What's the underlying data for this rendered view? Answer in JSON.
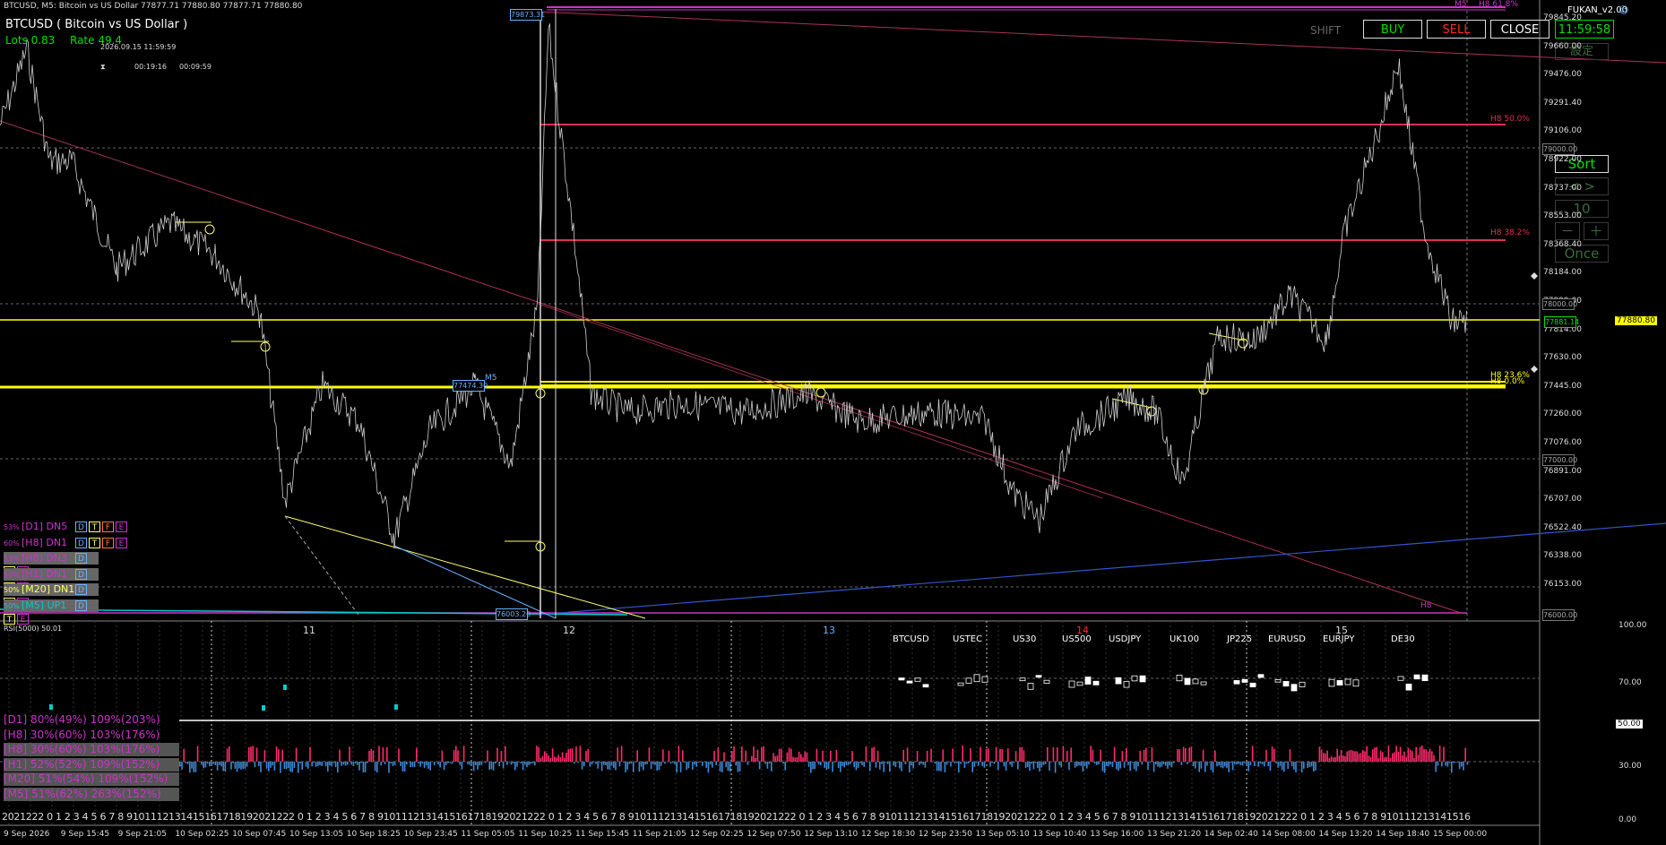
{
  "header": {
    "title": "BTCUSD, M5:  Bitcoin vs US Dollar  77877.71 77880.80 77877.71 77880.80",
    "symbol_label": "BTCUSD ( Bitcoin vs US Dollar )",
    "lots": "Lots  0.83",
    "rate": "Rate  49.4",
    "datetime": "2026.09.15 11:59:59",
    "timer_a": "00:19:16",
    "timer_b": "00:09:59",
    "timer_icon": "hourglass-icon"
  },
  "panel": {
    "ea_name": "FUKAN_v2.00",
    "shift_label": "SHIFT",
    "buy_label": "BUY",
    "sell_label": "SELL",
    "close_label": "CLOSE",
    "clock": "11:59:58",
    "settings_label": "設定",
    "sort_label": "Sort",
    "nav_label": "< >",
    "count_value": "10",
    "minus_label": "－",
    "plus_label": "＋",
    "once_label": "Once",
    "colors": {
      "buy": "#00e000",
      "sell": "#ff2a2a",
      "close": "#ffffff"
    }
  },
  "price_axis": {
    "labels": [
      "79845.20",
      "79660.00",
      "79476.00",
      "79291.40",
      "79106.00",
      "78922.00",
      "78737.00",
      "78553.00",
      "78368.40",
      "78184.00",
      "77999.00",
      "77814.00",
      "77630.00",
      "77445.00",
      "77260.00",
      "77076.00",
      "76891.00",
      "76707.00",
      "76522.40",
      "76338.00",
      "76153.00"
    ],
    "current_price": "77880.80",
    "current_color": "#ffff00",
    "ask_price": "77881.14"
  },
  "price_tags": {
    "p79873": "79873.31",
    "p79000": "79000.00",
    "p78000": "78000.00",
    "p77000": "77000.00",
    "p76000": "76000.00",
    "p77474": "77474.30",
    "p76003": "76003.20"
  },
  "fib_levels": {
    "h8_50": "H8 50.0%",
    "h8_38": "H8 38.2%",
    "h8_23": "H8 23.6%",
    "h8_0": "H8 0.0%",
    "h8_bottom": "H8",
    "m5_top": "M5",
    "m5_mid": "M5",
    "h8_top": "H8 61.8%"
  },
  "trend_rows": [
    {
      "pct": "53%",
      "tf": "[D1]",
      "dir": "DN5",
      "color": "#cc33cc",
      "boxes": [
        "D",
        "T",
        "F",
        "E"
      ]
    },
    {
      "pct": "60%",
      "tf": "[H8]",
      "dir": "DN1",
      "color": "#cc33cc",
      "boxes": [
        "D",
        "T",
        "F",
        "E"
      ]
    },
    {
      "pct": "53%",
      "tf": "[H8]",
      "dir": "DN3",
      "color": "#cc33cc",
      "boxes": [
        "D",
        "T",
        "E"
      ]
    },
    {
      "pct": "50%",
      "tf": "[H1]",
      "dir": "DN1",
      "color": "#cc33cc",
      "boxes": [
        "D",
        "T",
        "E"
      ]
    },
    {
      "pct": "50%",
      "tf": "[M20]",
      "dir": "DN1",
      "color": "#ffff66",
      "boxes": [
        "D",
        "T",
        "E"
      ]
    },
    {
      "pct": "50%",
      "tf": "[M5]",
      "dir": "UP1",
      "color": "#00cccc",
      "boxes": [
        "D",
        "T",
        "E"
      ]
    }
  ],
  "date_markers": {
    "d11": "11",
    "d12": "12",
    "d13": "13",
    "d14": "14",
    "d15": "15"
  },
  "rsi": {
    "label": "RSI(5000)",
    "value": "50.01",
    "levels": [
      "100.00",
      "70.00",
      "50.00",
      "30.00",
      "0.00"
    ]
  },
  "symbols": [
    "BTCUSD",
    "USTEC",
    "US30",
    "US500",
    "USDJPY",
    "UK100",
    "JP225",
    "EURUSD",
    "EURJPY",
    "DE30"
  ],
  "perf_rows": [
    {
      "text": "[D1] 80%(49%)  109%(203%)",
      "color": "#cc33cc"
    },
    {
      "text": "[H8] 30%(60%)  103%(176%)",
      "color": "#cc33cc"
    },
    {
      "text": "[H8] 30%(60%)  103%(176%)",
      "color": "#cc33cc"
    },
    {
      "text": "[H1] 52%(52%)  109%(152%)",
      "color": "#cc33cc"
    },
    {
      "text": "[M20] 51%(54%)  109%(152%)",
      "color": "#cc33cc"
    },
    {
      "text": "[M5] 51%(62%)  263%(152%)",
      "color": "#cc33cc"
    }
  ],
  "time_axis": [
    "9 Sep 2026",
    "9 Sep 15:45",
    "9 Sep 21:05",
    "10 Sep 02:25",
    "10 Sep 07:45",
    "10 Sep 13:05",
    "10 Sep 18:25",
    "10 Sep 23:45",
    "11 Sep 05:05",
    "11 Sep 10:25",
    "11 Sep 15:45",
    "11 Sep 21:05",
    "12 Sep 02:25",
    "12 Sep 07:50",
    "12 Sep 13:10",
    "12 Sep 18:30",
    "12 Sep 23:50",
    "13 Sep 05:10",
    "13 Sep 10:40",
    "13 Sep 16:00",
    "13 Sep 21:20",
    "14 Sep 02:40",
    "14 Sep 08:00",
    "14 Sep 13:20",
    "14 Sep 18:40",
    "15 Sep 00:00"
  ],
  "hour_row": "2021222 0 1 2 3 4 5 6 7 8 9101112131415161718192021222 0 1 2 3 4 5 6 7 8 9101112131415161718192021222 0 1 2 3 4 5 6 7 8 9101112131415161718192021222 0 1 2 3 4 5 6 7 8 9101112131415161718192021222 0 1 2 3 4 5 6 7 8 9101112131415161718192021222 0 1 2 3 4 5 6 7 8 9101112131415161718192021222 0 1 2 3 4 5 6 7 8 9101"
}
